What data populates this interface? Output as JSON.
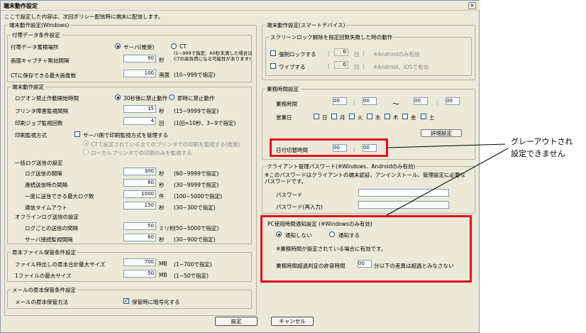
{
  "window": {
    "title": "端末動作設定",
    "close": "×"
  },
  "intro": "ここで設定した内容は、次回ポリシー配信時に端末に配信します。",
  "windows": {
    "group_label": "端末動作設定(Windows)",
    "ledger": {
      "group_label": "付帯データ条件設定",
      "store_label": "付帯データ蓄積場所",
      "store_server": "サーバ(推奨)",
      "store_ct": "CT",
      "capture_label": "画面キャプチャ無効間隔",
      "capture_value": "60",
      "capture_unit": "秒",
      "capture_note": "(1~999で指定、60秒未満した場合はCTの高負荷になる可能性があります)",
      "maxcount_label": "CTに保存できる最大画像数",
      "maxcount_value": "100",
      "maxcount_unit": "画面",
      "maxcount_note": "(10~999で指定)"
    },
    "terminal": {
      "group_label": "端末動作設定",
      "logon_label": "ログオン禁止作動開始時間",
      "logon_30": "30秒後に禁止動作",
      "logon_now": "即時に禁止動作",
      "printer_label": "プリンタ障害監視間隔",
      "printer_value": "15",
      "printer_unit": "秒",
      "printer_note": "(15~9999で指定)",
      "printjob_label": "印刷ジョブ監視回数",
      "printjob_value": "4",
      "printjob_unit": "回",
      "printjob_note": "(1回=10秒、3~9で指定)",
      "printmon_label": "印刷監視方式",
      "printmon_cb": "サーバ側で印刷監視方式を管理する",
      "printmon_opt1": "CTで設定されている全てのプリンタでの印刷を監視する(推奨)",
      "printmon_opt2": "ローカルプリンタでの印刷のみを監視する",
      "bulk_label": "一括ログ送信の設定",
      "log_interval_label": "ログ送信の間隔",
      "log_interval_value": "300",
      "log_interval_unit": "秒",
      "log_interval_note": "(60~9999で指定)",
      "fail_interval_label": "連続送信時の間隔",
      "fail_interval_value": "60",
      "fail_interval_unit": "秒",
      "fail_interval_note": "(30~9999で指定)",
      "maxlogs_label": "一度に送信できる最大ログ数",
      "maxlogs_value": "1000",
      "maxlogs_unit": "件",
      "maxlogs_note": "(100~5000で指定)",
      "timeout_label": "通信タイムアウト",
      "timeout_value": "150",
      "timeout_unit": "秒",
      "timeout_note": "(30~300で指定)",
      "offline_label": "オフラインログ送信の設定",
      "offline_each_label": "ログごとの送信の間隔",
      "offline_each_value": "50",
      "offline_each_unit": "ミリ秒",
      "offline_each_note": "(50~5000で指定)",
      "server_mon_label": "サーバ接続監視間隔",
      "server_mon_value": "60",
      "server_mon_unit": "秒",
      "server_mon_note": "(30~900で指定)"
    },
    "file": {
      "group_label": "原本ファイル保管条件設定",
      "total_label": "ファイル持出しの原本合計最大サイズ",
      "total_value": "700",
      "total_unit": "MB",
      "total_note": "(1~700で指定)",
      "single_label": "1ファイルの最大サイズ",
      "single_value": "50",
      "single_unit": "MB",
      "single_note": "(1~50で指定)"
    },
    "mail": {
      "group_label": "メールの原本保管条件設定",
      "method_label": "メールの原本保管方法",
      "encrypt_cb": "保管時に暗号化する"
    }
  },
  "smart": {
    "group_label": "端末動作設定(スマートデバイス)",
    "lock_group": "スクリーンロック解除を指定回数失敗した時の動作",
    "force_lock": "強制ロックする",
    "force_lock_value": "0",
    "force_lock_unit": "回",
    "force_lock_note": "※Androidのみ有効",
    "wipe": "ワイプする",
    "wipe_value": "0",
    "wipe_unit": "回",
    "wipe_note": "※Android、iOSで有効"
  },
  "business": {
    "group_label": "業務時間設定",
    "hours_label": "業務時間",
    "start_h": "00",
    "start_m": "00",
    "end_h": "00",
    "end_m": "00",
    "colon": ":",
    "tilde": "～",
    "days_label": "営業日",
    "days": [
      "日",
      "月",
      "火",
      "水",
      "木",
      "金",
      "土"
    ],
    "detail_button": "詳細設定",
    "date_change_label": "日付切替時間",
    "date_change_h": "00",
    "date_change_m": "00"
  },
  "client_pw": {
    "group_label": "クライアント管理パスワード(※Windows、Androidのみ有効)",
    "note": "※このパスワードはクライアントの端末認証、アンインストール、管理設定に必要なパスワードです。",
    "pw_label": "パスワード",
    "pw_value": "",
    "pw_confirm_label": "パスワード(再入力)",
    "pw_confirm_value": ""
  },
  "pc_notice": {
    "group_label": "PC使用時間通知設定 (※Windowsのみ有効)",
    "no_notify": "通知しない",
    "notify": "通知する",
    "note": "※業務時間が設定されている場合に有効です。",
    "tolerance_label": "業務時間超過判定の許容時間",
    "tolerance_value": "00",
    "tolerance_suffix": "分以下の差異は超過とみなさない"
  },
  "buttons": {
    "ok": "設定",
    "cancel": "キャンセル"
  },
  "annotation": {
    "line1": "グレーアウトされ",
    "line2": "設定できません"
  },
  "colors": {
    "highlight": "#e0101a",
    "dialog_bg": "#ece9d8"
  }
}
